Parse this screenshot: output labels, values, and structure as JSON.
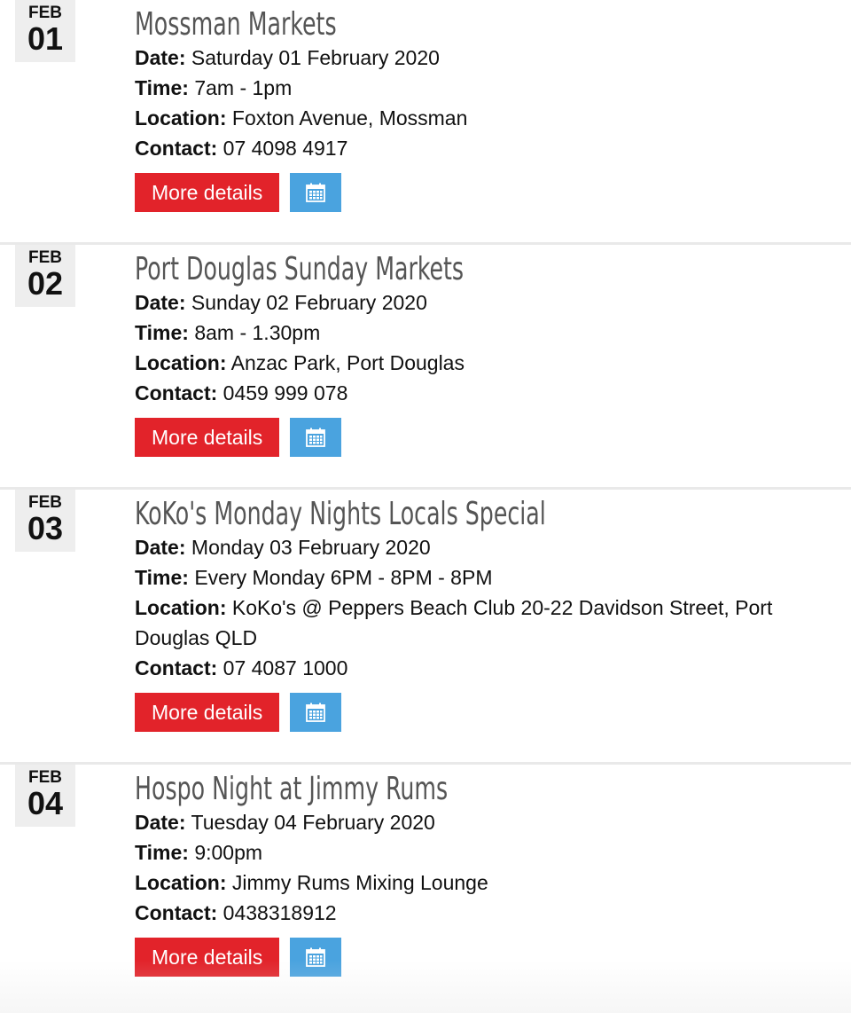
{
  "labels": {
    "date": "Date:",
    "time": "Time:",
    "location": "Location:",
    "contact": "Contact:",
    "more_details": "More details"
  },
  "events": [
    {
      "month": "FEB",
      "day": "01",
      "title": "Mossman Markets",
      "date": "Saturday 01 February 2020",
      "time": "7am - 1pm",
      "location": "Foxton Avenue, Mossman",
      "contact": "07 4098 4917"
    },
    {
      "month": "FEB",
      "day": "02",
      "title": "Port Douglas Sunday Markets",
      "date": "Sunday 02 February 2020",
      "time": "8am - 1.30pm",
      "location": "Anzac Park, Port Douglas",
      "contact": "0459 999 078"
    },
    {
      "month": "FEB",
      "day": "03",
      "title": "KoKo's Monday Nights Locals Special",
      "date": "Monday 03 February 2020",
      "time": "Every Monday 6PM - 8PM - 8PM",
      "location": "KoKo's @ Peppers Beach Club 20-22 Davidson Street, Port Douglas QLD",
      "contact": "07 4087 1000"
    },
    {
      "month": "FEB",
      "day": "04",
      "title": "Hospo Night at Jimmy Rums",
      "date": "Tuesday 04 February 2020",
      "time": "9:00pm",
      "location": "Jimmy Rums Mixing Lounge",
      "contact": "0438318912"
    }
  ],
  "icons": {
    "calendar": "calendar-icon"
  },
  "colors": {
    "more_button": "#e2232a",
    "calendar_button": "#4aa3df",
    "title": "#555555",
    "date_badge_bg": "#eeeeee"
  }
}
